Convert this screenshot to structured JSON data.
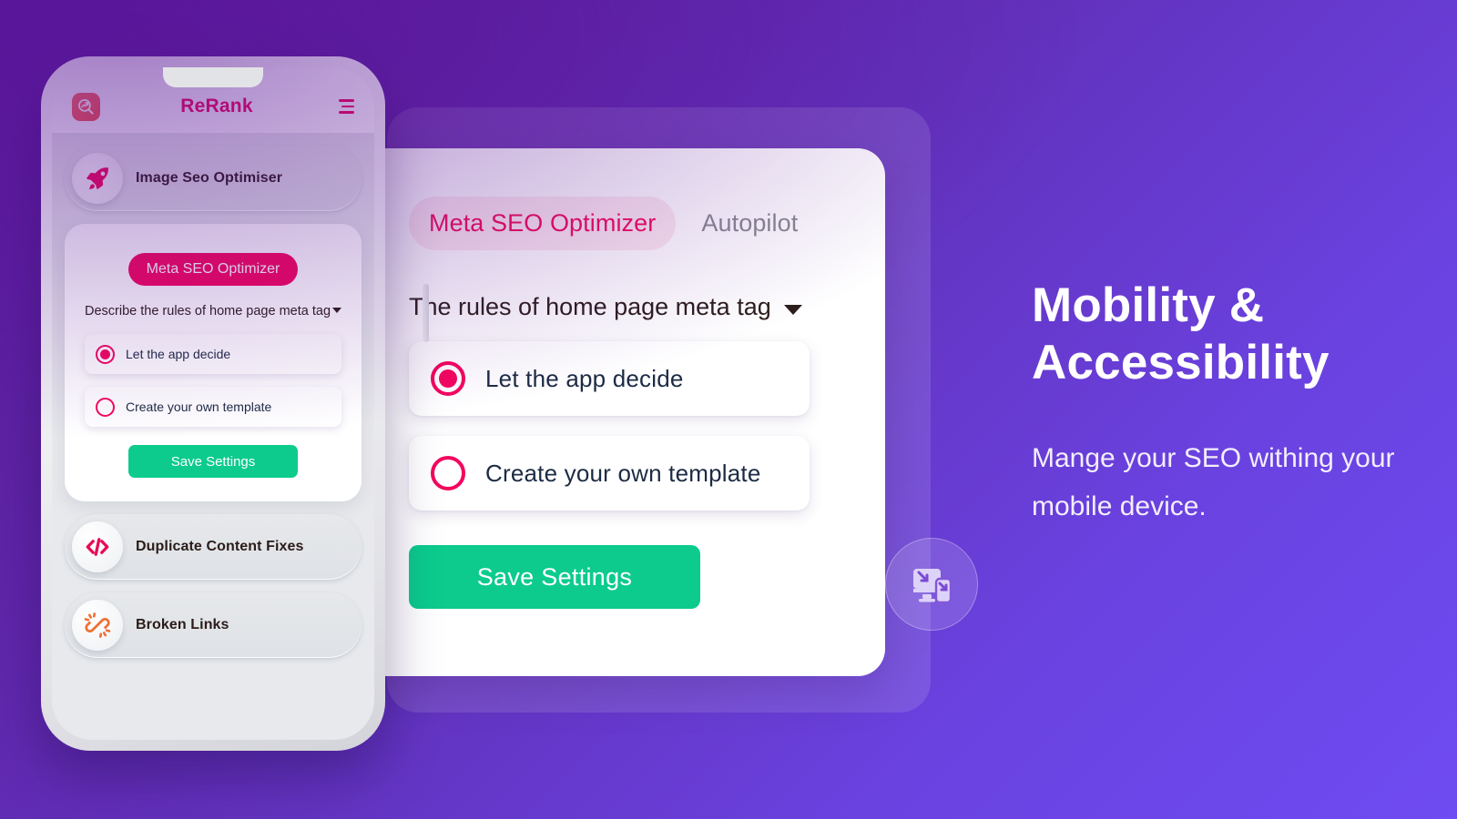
{
  "background": {
    "gradient_from": "#5c1a9e",
    "gradient_to": "#6e4bf2"
  },
  "phone": {
    "header": {
      "logo_icon": "seo-search-growth-icon",
      "app_title": "ReRank",
      "menu_icon": "hamburger-menu-icon"
    },
    "menu_items": [
      {
        "icon": "rocket-icon",
        "label": "Image Seo Optimiser"
      },
      {
        "icon": "code-brackets-icon",
        "label": "Duplicate Content Fixes"
      },
      {
        "icon": "broken-link-icon",
        "label": "Broken Links"
      }
    ],
    "card": {
      "pill_label": "Meta SEO Optimizer",
      "description": "Describe the rules of home page meta tag",
      "options": [
        {
          "label": "Let the app decide",
          "selected": true
        },
        {
          "label": "Create your own template",
          "selected": false
        }
      ],
      "save_label": "Save Settings"
    }
  },
  "panel": {
    "tabs": [
      {
        "label": "Meta SEO Optimizer",
        "active": true
      },
      {
        "label": "Autopilot",
        "active": false
      }
    ],
    "dropdown_label": "The rules of home page meta tag",
    "dropdown_icon": "chevron-down-icon",
    "options": [
      {
        "label": "Let the app decide",
        "selected": true
      },
      {
        "label": "Create your own template",
        "selected": false
      }
    ],
    "save_label": "Save Settings"
  },
  "badge": {
    "icon": "responsive-devices-icon"
  },
  "copy": {
    "heading_line1": "Mobility &",
    "heading_line2": "Accessibility",
    "subtext": "Mange your SEO withing your mobile device."
  },
  "colors": {
    "accent_pink": "#f5065e",
    "accent_green": "#0ccb8d",
    "tab_active_bg": "#fdeaf0",
    "logo_red": "#f9514c",
    "heading_white": "#ffffff"
  }
}
